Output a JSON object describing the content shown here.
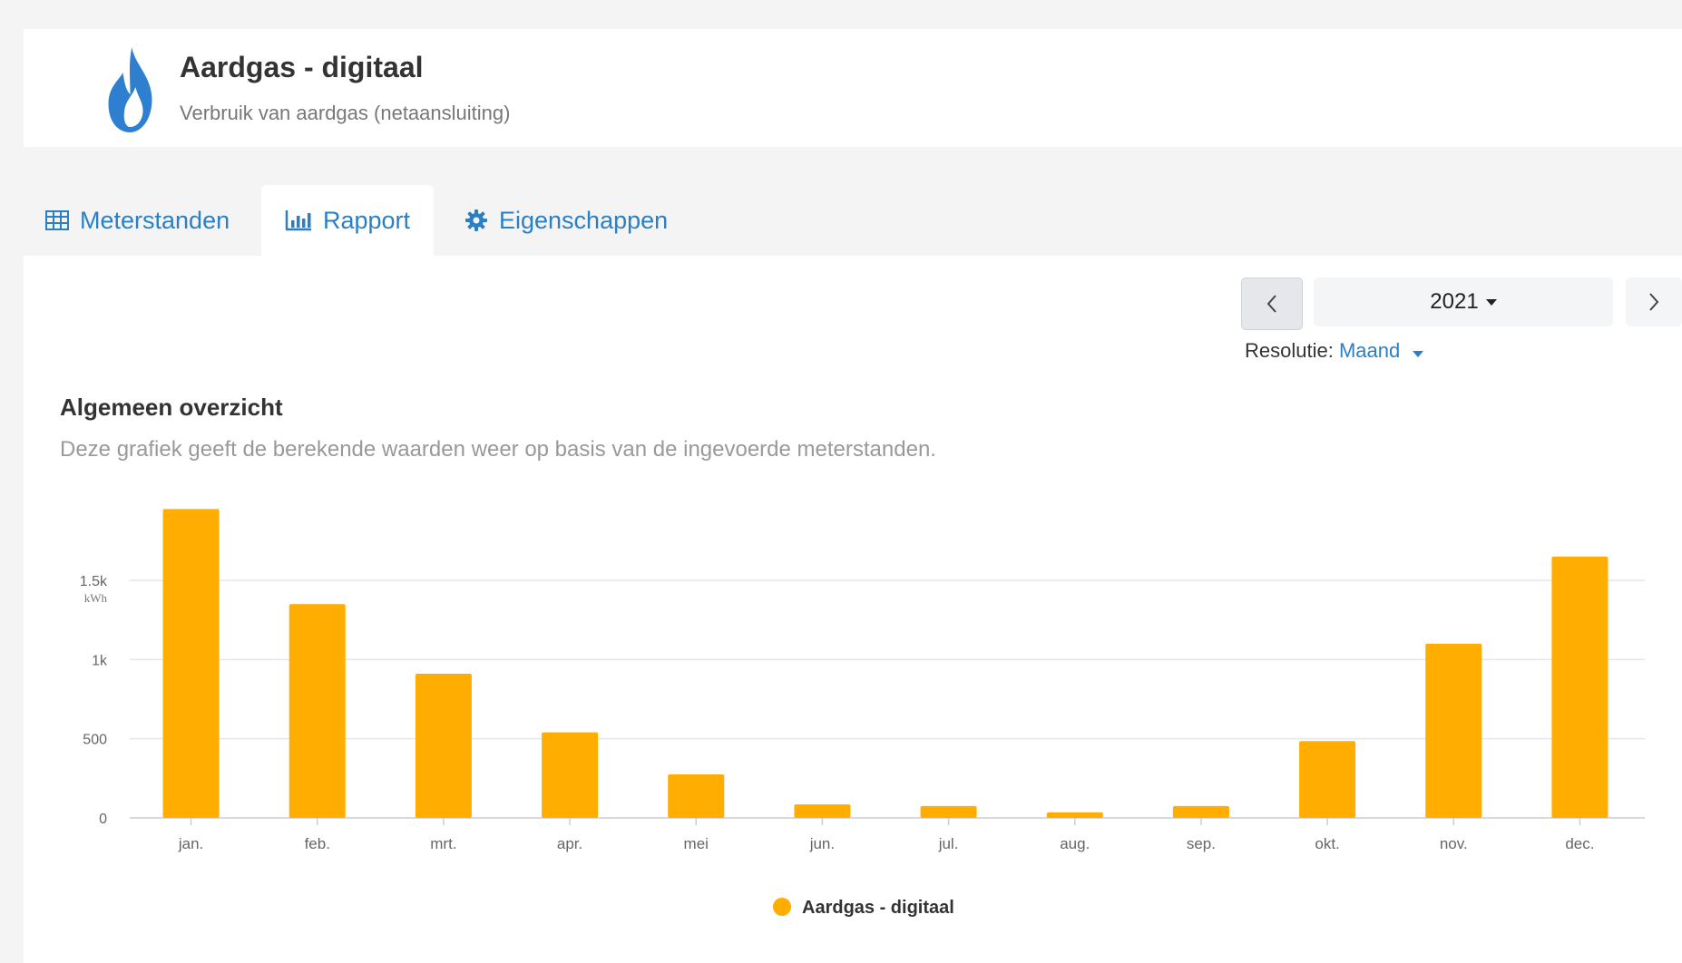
{
  "header": {
    "title": "Aardgas - digitaal",
    "subtitle": "Verbruik van aardgas (netaansluiting)",
    "icon": "flame-icon",
    "icon_color": "#2f7fd1"
  },
  "tabs": [
    {
      "label": "Meterstanden",
      "icon": "table-icon",
      "active": false
    },
    {
      "label": "Rapport",
      "icon": "bar-chart-icon",
      "active": true
    },
    {
      "label": "Eigenschappen",
      "icon": "gear-icon",
      "active": false
    }
  ],
  "controls": {
    "year": "2021",
    "resolution_label": "Resolutie:",
    "resolution_value": "Maand"
  },
  "section": {
    "title": "Algemeen overzicht",
    "description": "Deze grafiek geeft de berekende waarden weer op basis van de ingevoerde meterstanden."
  },
  "colors": {
    "accent": "#2a7fc5",
    "bar": "#ffad00",
    "grid": "#e3e6ea"
  },
  "chart_data": {
    "type": "bar",
    "categories": [
      "jan.",
      "feb.",
      "mrt.",
      "apr.",
      "mei",
      "jun.",
      "jul.",
      "aug.",
      "sep.",
      "okt.",
      "nov.",
      "dec."
    ],
    "series": [
      {
        "name": "Aardgas - digitaal",
        "values": [
          1950,
          1350,
          910,
          540,
          275,
          85,
          75,
          35,
          75,
          485,
          1100,
          1650
        ]
      }
    ],
    "ylabel": "kWh",
    "yticks": [
      0,
      500,
      1000,
      1500
    ],
    "ytick_labels": [
      "0",
      "500",
      "1k",
      "1.5k"
    ],
    "ylim": [
      0,
      2000
    ],
    "grid": true,
    "legend_position": "bottom-center"
  }
}
